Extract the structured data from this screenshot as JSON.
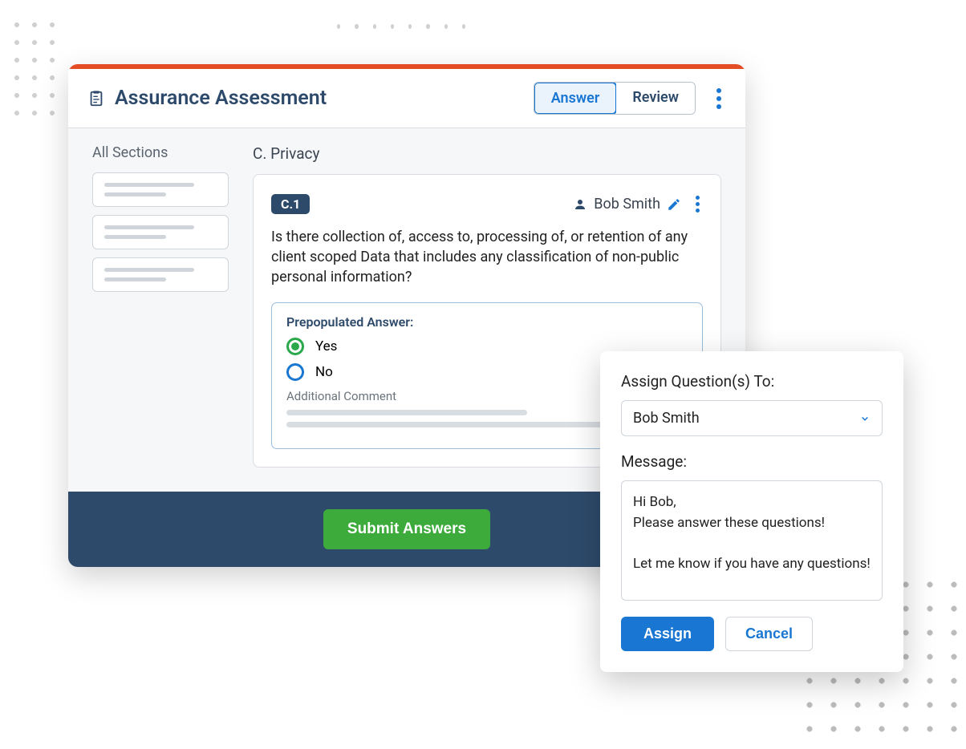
{
  "header": {
    "title": "Assurance Assessment",
    "tabs": {
      "answer": "Answer",
      "review": "Review"
    }
  },
  "sidebar": {
    "title": "All Sections"
  },
  "section": {
    "heading": "C. Privacy",
    "question": {
      "badge": "C.1",
      "assignee": "Bob Smith",
      "text": "Is there collection of, access to, processing of, or retention of any client scoped Data that includes any classification of non-public personal information?",
      "answer_label": "Prepopulated Answer:",
      "options": {
        "yes": "Yes",
        "no": "No"
      },
      "selected": "yes",
      "comment_label": "Additional Comment"
    }
  },
  "footer": {
    "submit": "Submit Answers"
  },
  "popup": {
    "assign_label": "Assign Question(s) To:",
    "assignee": "Bob Smith",
    "message_label": "Message:",
    "message": "Hi Bob,\nPlease answer these questions!\n\nLet me know if you have any questions!",
    "assign_btn": "Assign",
    "cancel_btn": "Cancel"
  }
}
